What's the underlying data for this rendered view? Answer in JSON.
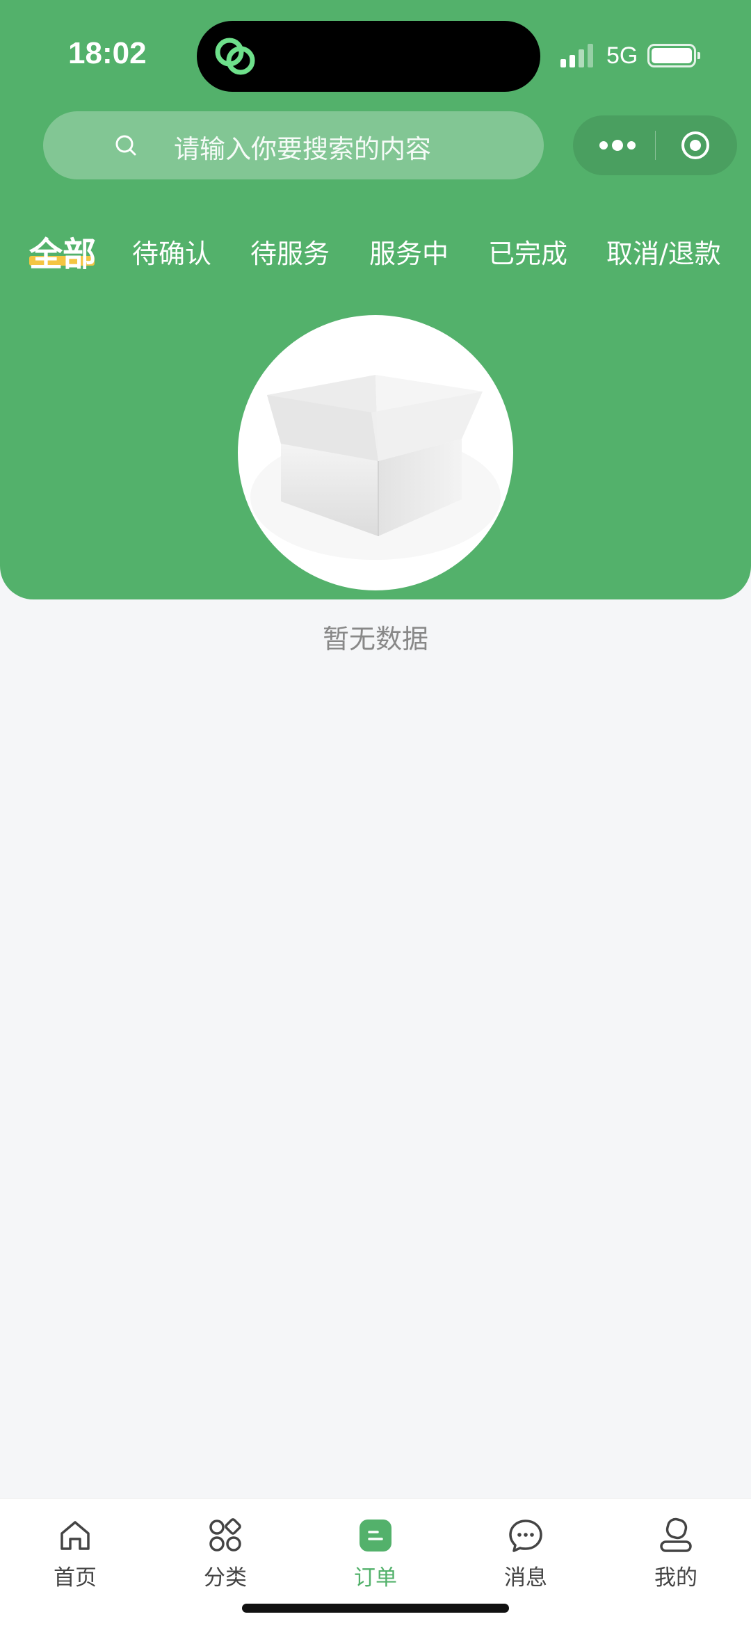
{
  "status_bar": {
    "time": "18:02",
    "network": "5G",
    "icons": [
      "app-logo-icon",
      "signal-icon",
      "battery-icon"
    ]
  },
  "search": {
    "placeholder": "请输入你要搜索的内容",
    "icon": "search-icon"
  },
  "capsule": {
    "icons": [
      "more-dots-icon",
      "close-target-icon"
    ]
  },
  "tabs": [
    {
      "label": "全部",
      "active": true
    },
    {
      "label": "待确认",
      "active": false
    },
    {
      "label": "待服务",
      "active": false
    },
    {
      "label": "服务中",
      "active": false
    },
    {
      "label": "已完成",
      "active": false
    },
    {
      "label": "取消/退款",
      "active": false
    }
  ],
  "empty_state": {
    "icon": "empty-box-icon",
    "text": "暂无数据"
  },
  "bottom_nav": [
    {
      "label": "首页",
      "icon": "home-icon",
      "active": false
    },
    {
      "label": "分类",
      "icon": "category-icon",
      "active": false
    },
    {
      "label": "订单",
      "icon": "order-icon",
      "active": true
    },
    {
      "label": "消息",
      "icon": "message-icon",
      "active": false
    },
    {
      "label": "我的",
      "icon": "profile-icon",
      "active": false
    }
  ],
  "colors": {
    "brand_green": "#53b16b",
    "tab_underline": "#f4c542",
    "page_bg": "#f5f6f8"
  }
}
